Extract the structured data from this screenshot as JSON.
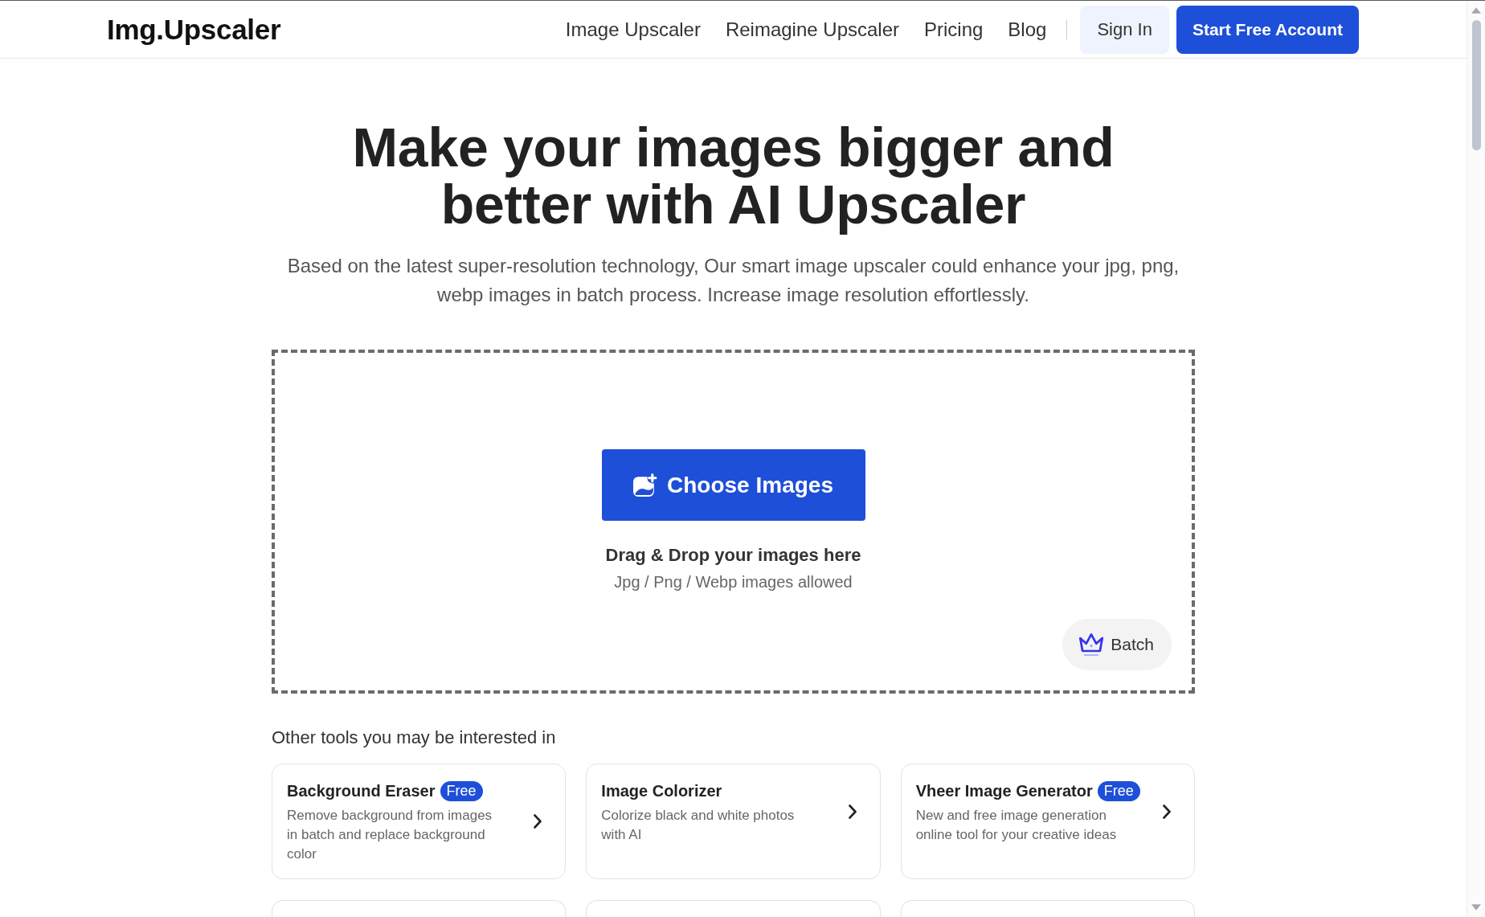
{
  "header": {
    "logo": "Img.Upscaler",
    "nav_links": [
      "Image Upscaler",
      "Reimagine Upscaler",
      "Pricing",
      "Blog"
    ],
    "sign_in": "Sign In",
    "start_free": "Start Free Account"
  },
  "hero": {
    "title": "Make your images bigger and better with AI Upscaler",
    "subtitle": "Based on the latest super-resolution technology, Our smart image upscaler could enhance your jpg, png, webp images in batch process. Increase image resolution effortlessly."
  },
  "upload": {
    "button": "Choose Images",
    "drop_hint": "Drag & Drop your images here",
    "formats": "Jpg / Png / Webp images allowed",
    "batch_button": "Batch"
  },
  "other_tools": {
    "heading": "Other tools you may be interested in",
    "cards": [
      {
        "kind": "tool",
        "title": "Background Eraser",
        "badge": "Free",
        "description": "Remove background from images in batch and replace background color"
      },
      {
        "kind": "tool",
        "title": "Image Colorizer",
        "description": "Colorize black and white photos with AI"
      },
      {
        "kind": "tool",
        "title": "Vheer Image Generator",
        "badge": "Free",
        "description": "New and free image generation online tool for your creative ideas"
      },
      {
        "kind": "cut-off"
      },
      {
        "kind": "cut-off"
      },
      {
        "kind": "cut-off"
      }
    ]
  }
}
